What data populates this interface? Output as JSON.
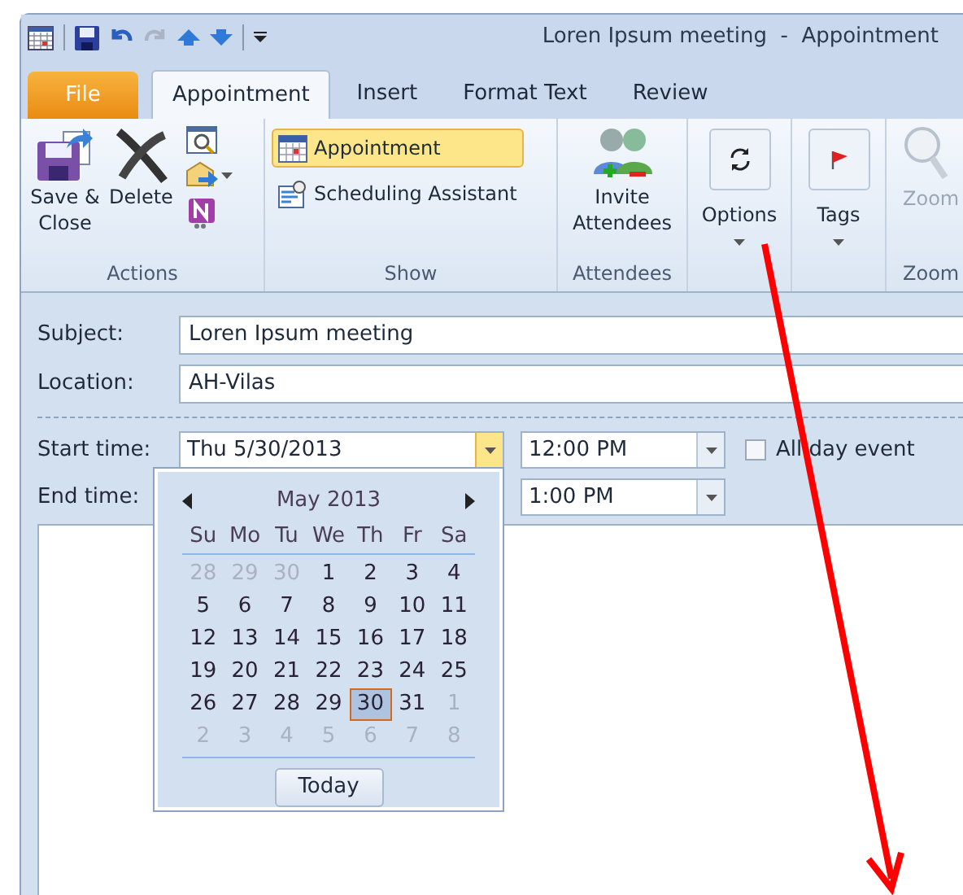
{
  "window": {
    "title": "Loren Ipsum meeting  -  Appointment"
  },
  "tabs": [
    {
      "label": "File",
      "kind": "file",
      "selected": false
    },
    {
      "label": "Appointment",
      "kind": "tab",
      "selected": true
    },
    {
      "label": "Insert",
      "kind": "tab",
      "selected": false
    },
    {
      "label": "Format Text",
      "kind": "tab",
      "selected": false
    },
    {
      "label": "Review",
      "kind": "tab",
      "selected": false
    }
  ],
  "ribbon": {
    "actions": {
      "save_close": "Save &\nClose",
      "delete": "Delete",
      "label": "Actions"
    },
    "show": {
      "items": [
        {
          "label": "Appointment",
          "selected": true
        },
        {
          "label": "Scheduling Assistant",
          "selected": false
        }
      ],
      "label": "Show"
    },
    "attendees": {
      "invite": "Invite\nAttendees",
      "label": "Attendees"
    },
    "options": {
      "label": "Options"
    },
    "tags": {
      "label": "Tags"
    },
    "zoom": {
      "button": "Zoom",
      "label": "Zoom"
    }
  },
  "form": {
    "subject": {
      "label": "Subject:",
      "value": "Loren Ipsum meeting"
    },
    "location": {
      "label": "Location:",
      "value": "AH-Vilas"
    },
    "start": {
      "label": "Start time:",
      "date": "Thu 5/30/2013",
      "time": "12:00 PM"
    },
    "end": {
      "label": "End time:",
      "time": "1:00 PM"
    },
    "all_day": {
      "label": "All day event",
      "checked": false
    }
  },
  "calendar": {
    "month": "May 2013",
    "weekdays": [
      "Su",
      "Mo",
      "Tu",
      "We",
      "Th",
      "Fr",
      "Sa"
    ],
    "weeks": [
      [
        {
          "day": "28",
          "in_month": false,
          "selected": false
        },
        {
          "day": "29",
          "in_month": false,
          "selected": false
        },
        {
          "day": "30",
          "in_month": false,
          "selected": false
        },
        {
          "day": "1",
          "in_month": true,
          "selected": false
        },
        {
          "day": "2",
          "in_month": true,
          "selected": false
        },
        {
          "day": "3",
          "in_month": true,
          "selected": false
        },
        {
          "day": "4",
          "in_month": true,
          "selected": false
        }
      ],
      [
        {
          "day": "5",
          "in_month": true,
          "selected": false
        },
        {
          "day": "6",
          "in_month": true,
          "selected": false
        },
        {
          "day": "7",
          "in_month": true,
          "selected": false
        },
        {
          "day": "8",
          "in_month": true,
          "selected": false
        },
        {
          "day": "9",
          "in_month": true,
          "selected": false
        },
        {
          "day": "10",
          "in_month": true,
          "selected": false
        },
        {
          "day": "11",
          "in_month": true,
          "selected": false
        }
      ],
      [
        {
          "day": "12",
          "in_month": true,
          "selected": false
        },
        {
          "day": "13",
          "in_month": true,
          "selected": false
        },
        {
          "day": "14",
          "in_month": true,
          "selected": false
        },
        {
          "day": "15",
          "in_month": true,
          "selected": false
        },
        {
          "day": "16",
          "in_month": true,
          "selected": false
        },
        {
          "day": "17",
          "in_month": true,
          "selected": false
        },
        {
          "day": "18",
          "in_month": true,
          "selected": false
        }
      ],
      [
        {
          "day": "19",
          "in_month": true,
          "selected": false
        },
        {
          "day": "20",
          "in_month": true,
          "selected": false
        },
        {
          "day": "21",
          "in_month": true,
          "selected": false
        },
        {
          "day": "22",
          "in_month": true,
          "selected": false
        },
        {
          "day": "23",
          "in_month": true,
          "selected": false
        },
        {
          "day": "24",
          "in_month": true,
          "selected": false
        },
        {
          "day": "25",
          "in_month": true,
          "selected": false
        }
      ],
      [
        {
          "day": "26",
          "in_month": true,
          "selected": false
        },
        {
          "day": "27",
          "in_month": true,
          "selected": false
        },
        {
          "day": "28",
          "in_month": true,
          "selected": false
        },
        {
          "day": "29",
          "in_month": true,
          "selected": false
        },
        {
          "day": "30",
          "in_month": true,
          "selected": true
        },
        {
          "day": "31",
          "in_month": true,
          "selected": false
        },
        {
          "day": "1",
          "in_month": false,
          "selected": false
        }
      ],
      [
        {
          "day": "2",
          "in_month": false,
          "selected": false
        },
        {
          "day": "3",
          "in_month": false,
          "selected": false
        },
        {
          "day": "4",
          "in_month": false,
          "selected": false
        },
        {
          "day": "5",
          "in_month": false,
          "selected": false
        },
        {
          "day": "6",
          "in_month": false,
          "selected": false
        },
        {
          "day": "7",
          "in_month": false,
          "selected": false
        },
        {
          "day": "8",
          "in_month": false,
          "selected": false
        }
      ]
    ],
    "today": "Today"
  }
}
